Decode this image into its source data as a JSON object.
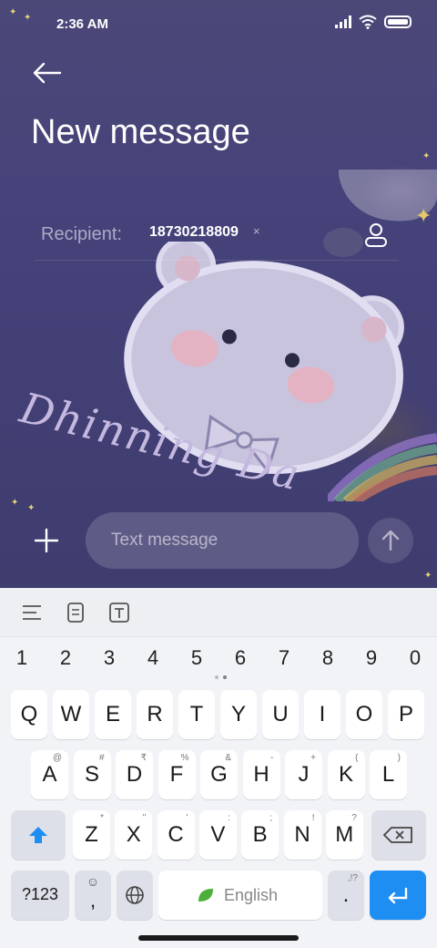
{
  "status": {
    "time": "2:36 AM"
  },
  "header": {
    "title": "New message"
  },
  "recipient": {
    "label": "Recipient:",
    "value": "18730218809",
    "remove": "×"
  },
  "wallpaper_text": "Dhinning Da",
  "compose": {
    "placeholder": "Text message"
  },
  "keyboard": {
    "numbers": [
      "1",
      "2",
      "3",
      "4",
      "5",
      "6",
      "7",
      "8",
      "9",
      "0"
    ],
    "row1": [
      "Q",
      "W",
      "E",
      "R",
      "T",
      "Y",
      "U",
      "I",
      "O",
      "P"
    ],
    "row2": [
      {
        "k": "A",
        "s": "@"
      },
      {
        "k": "S",
        "s": "#"
      },
      {
        "k": "D",
        "s": "₹"
      },
      {
        "k": "F",
        "s": "%"
      },
      {
        "k": "G",
        "s": "&"
      },
      {
        "k": "H",
        "s": "-"
      },
      {
        "k": "J",
        "s": "+"
      },
      {
        "k": "K",
        "s": "("
      },
      {
        "k": "L",
        "s": ")"
      }
    ],
    "row3": [
      {
        "k": "Z",
        "s": "*"
      },
      {
        "k": "X",
        "s": "\""
      },
      {
        "k": "C",
        "s": "'"
      },
      {
        "k": "V",
        "s": ":"
      },
      {
        "k": "B",
        "s": ";"
      },
      {
        "k": "N",
        "s": "!"
      },
      {
        "k": "M",
        "s": "?"
      }
    ],
    "symbols_label": "?123",
    "comma": ",",
    "space_label": "English",
    "period": ".",
    "period_sub": ",!?",
    "accent": "#1e8ef2"
  }
}
